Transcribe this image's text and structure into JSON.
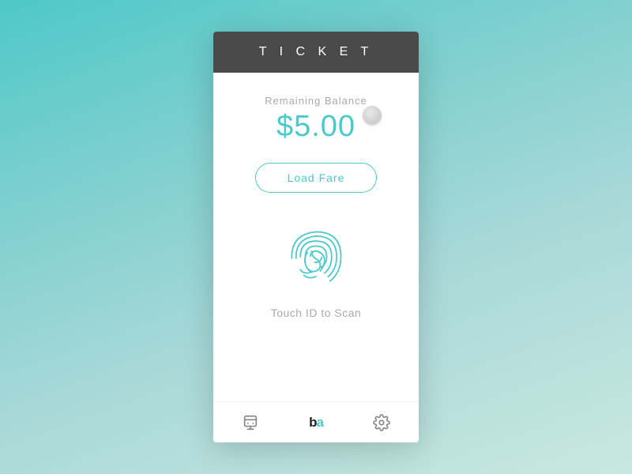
{
  "header": {
    "title": "T I C K E T"
  },
  "balance": {
    "label": "Remaining Balance",
    "amount": "$5.00"
  },
  "buttons": {
    "load_fare": "Load Fare"
  },
  "fingerprint": {
    "label": "Touch ID to Scan"
  },
  "nav": {
    "transit_icon": "transit",
    "brand_text": "b",
    "brand_highlight": "a",
    "settings_icon": "settings"
  },
  "colors": {
    "teal": "#4ec8c8",
    "header_bg": "#4a4a4a",
    "text_muted": "#aaaaaa"
  }
}
